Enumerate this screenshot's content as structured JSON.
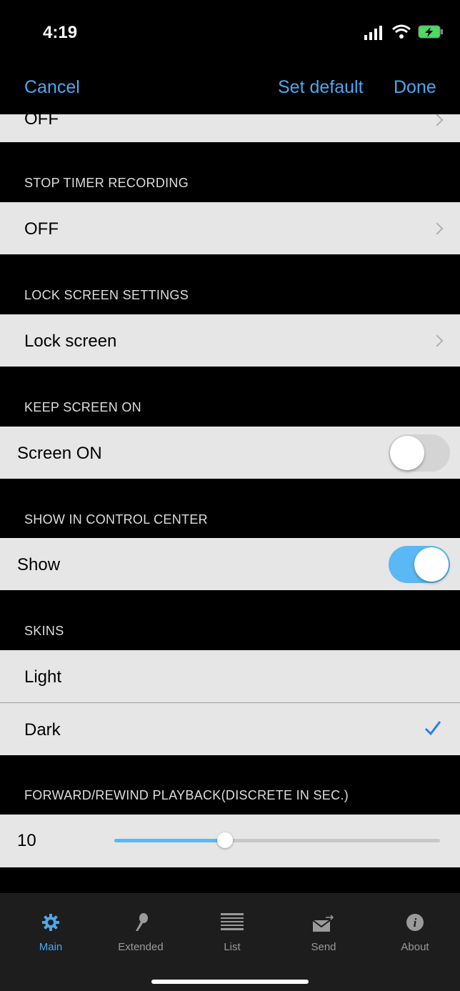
{
  "status_bar": {
    "time": "4:19"
  },
  "nav": {
    "cancel": "Cancel",
    "set_default": "Set default",
    "done": "Done"
  },
  "top_partial": {
    "value": "OFF"
  },
  "sections": {
    "stop_timer": {
      "header": "STOP TIMER RECORDING",
      "value": "OFF"
    },
    "lock_screen": {
      "header": "LOCK SCREEN SETTINGS",
      "value": "Lock screen"
    },
    "keep_screen": {
      "header": "KEEP SCREEN ON",
      "label": "Screen ON",
      "toggle_on": false
    },
    "control_center": {
      "header": "SHOW IN CONTROL CENTER",
      "label": "Show",
      "toggle_on": true
    },
    "skins": {
      "header": "SKINS",
      "options": [
        "Light",
        "Dark"
      ],
      "selected": "Dark"
    },
    "playback": {
      "header": "FORWARD/REWIND PLAYBACK(DISCRETE IN SEC.)",
      "value": "10",
      "slider_fraction": 0.34
    }
  },
  "tabs": [
    {
      "label": "Main",
      "icon": "gear-icon",
      "active": true
    },
    {
      "label": "Extended",
      "icon": "microphone-icon",
      "active": false
    },
    {
      "label": "List",
      "icon": "list-icon",
      "active": false
    },
    {
      "label": "Send",
      "icon": "send-envelope-icon",
      "active": false
    },
    {
      "label": "About",
      "icon": "info-icon",
      "active": false
    }
  ],
  "colors": {
    "accent": "#4aa8f0",
    "toggle_on": "#5ab8f5",
    "cell_bg": "#e6e6e6",
    "tab_active": "#4aa8f0",
    "tab_inactive": "#9a9a9a"
  }
}
